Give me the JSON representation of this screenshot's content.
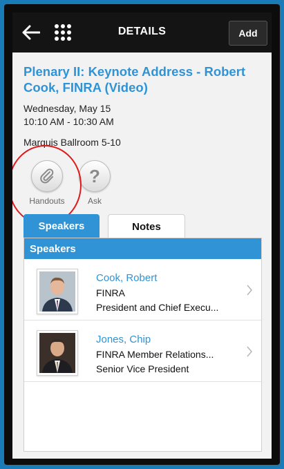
{
  "header": {
    "title": "DETAILS",
    "add_label": "Add"
  },
  "session": {
    "title": "Plenary II: Keynote Address - Robert Cook, FINRA (Video)",
    "date": "Wednesday, May 15",
    "time": "10:10 AM - 10:30 AM",
    "room": "Marquis Ballroom 5-10"
  },
  "actions": [
    {
      "label": "Handouts",
      "icon": "paperclip-icon"
    },
    {
      "label": "Ask",
      "icon": "question-icon",
      "glyph": "?"
    }
  ],
  "tabs": [
    {
      "label": "Speakers",
      "active": true
    },
    {
      "label": "Notes",
      "active": false
    }
  ],
  "speakers_panel": {
    "header": "Speakers",
    "items": [
      {
        "name": "Cook, Robert",
        "line1": "FINRA",
        "line2": "President and Chief Execu..."
      },
      {
        "name": "Jones, Chip",
        "line1": "FINRA Member Relations...",
        "line2": "Senior Vice President"
      }
    ]
  },
  "colors": {
    "accent": "#2f93d5",
    "topbar": "#141414",
    "frame": "#1b7bb6",
    "highlight": "#e01a1a"
  }
}
